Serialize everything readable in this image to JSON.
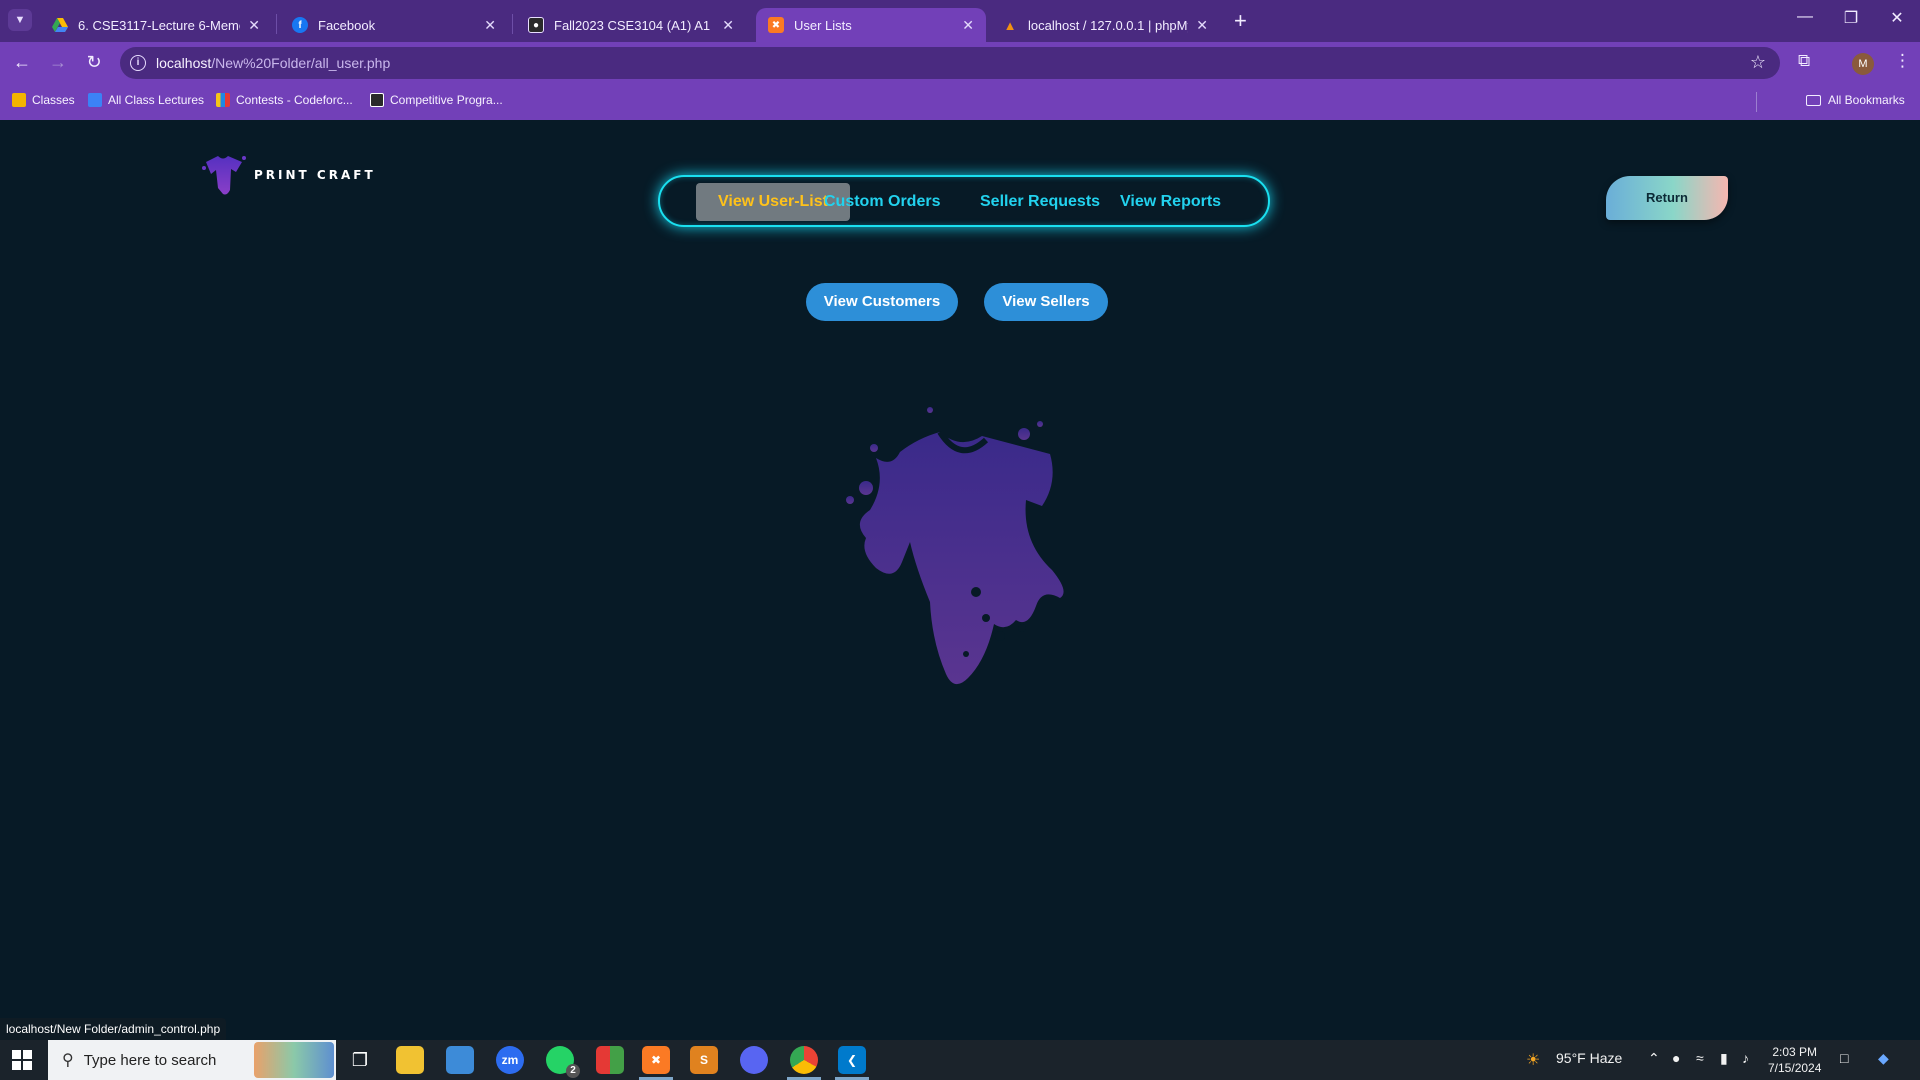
{
  "browser": {
    "tabs": [
      {
        "title": "6. CSE3117-Lecture 6-Memory",
        "icon": "google-drive-icon"
      },
      {
        "title": "Facebook",
        "icon": "facebook-icon"
      },
      {
        "title": "Fall2023 CSE3104 (A1) A1 Lab S",
        "icon": "classroom-icon"
      },
      {
        "title": "User Lists",
        "icon": "xampp-icon"
      },
      {
        "title": "localhost / 127.0.0.1 | phpMyAd",
        "icon": "phpmyadmin-icon"
      }
    ],
    "active_tab_index": 3,
    "url_host": "localhost",
    "url_path": "/New%20Folder/all_user.php",
    "profile_initial": "M",
    "bookmarks": [
      {
        "label": "Classes"
      },
      {
        "label": "All Class Lectures"
      },
      {
        "label": "Contests - Codeforc..."
      },
      {
        "label": "Competitive Progra..."
      }
    ],
    "all_bookmarks_label": "All Bookmarks"
  },
  "page": {
    "logo_text": "PRINT CRAFT",
    "nav": [
      {
        "label": "View User-List",
        "active": true
      },
      {
        "label": "Custom Orders",
        "active": false
      },
      {
        "label": "Seller Requests",
        "active": false
      },
      {
        "label": "View Reports",
        "active": false
      }
    ],
    "return_label": "Return",
    "view_customers_label": "View Customers",
    "view_sellers_label": "View Sellers",
    "status_url": "localhost/New Folder/admin_control.php"
  },
  "taskbar": {
    "search_placeholder": "Type here to search",
    "weather": "95°F  Haze",
    "time": "2:03 PM",
    "date": "7/15/2024",
    "whatsapp_badge": "2"
  },
  "colors": {
    "page_bg": "#071a26",
    "nav_glow": "#1ae0f0",
    "nav_text": "#22d2ee",
    "active_text": "#ffc21a",
    "button_blue": "#2d8fd8",
    "chrome_purple": "#7240b8"
  }
}
